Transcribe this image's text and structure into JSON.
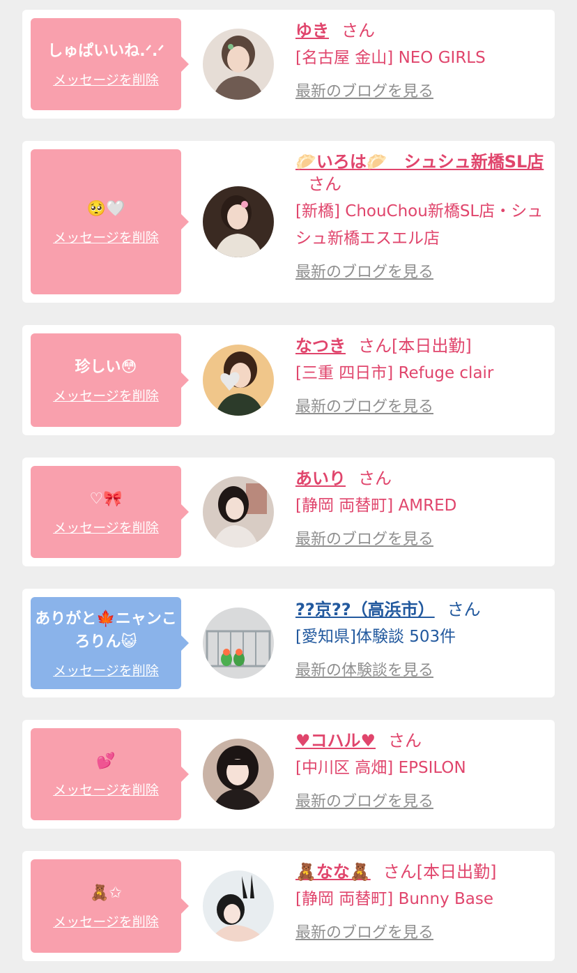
{
  "delete_label": "メッセージを削除",
  "colors": {
    "pink_bubble": "#f9a0ad",
    "blue_bubble": "#8ab3ea",
    "pink_text": "#e0456c",
    "blue_text": "#22599e",
    "link_gray": "#8f8f8f"
  },
  "items": [
    {
      "message": "しゅぱいいね.ᐟ.ᐟ",
      "name": "ゆき",
      "honorific": "さん",
      "extra": "",
      "shop": "[名古屋 金山] NEO GIRLS",
      "link": "最新のブログを見る",
      "theme": "pink",
      "avatar": "girl-photo"
    },
    {
      "message": "🥺🤍",
      "name": "🥟いろは🥟　シュシュ新橋SL店",
      "honorific": "さん",
      "extra": "",
      "shop": "[新橋] ChouChou新橋SL店・シュシュ新橋エスエル店",
      "link": "最新のブログを見る",
      "theme": "pink",
      "avatar": "girl-photo"
    },
    {
      "message": "珍しい😳",
      "name": "なつき",
      "honorific": "さん",
      "extra": "[本日出勤]",
      "shop": "[三重 四日市] Refuge clair",
      "link": "最新のブログを見る",
      "theme": "pink",
      "avatar": "girl-photo"
    },
    {
      "message": "♡🎀",
      "name": "あいり",
      "honorific": "さん",
      "extra": "",
      "shop": "[静岡 両替町] AMRED",
      "link": "最新のブログを見る",
      "theme": "pink",
      "avatar": "girl-photo"
    },
    {
      "message": "ありがと🍁ニャンころりん😺",
      "name": "??京??（高浜市）",
      "honorific": "さん",
      "extra": "",
      "shop": "[愛知県]体験談 503件",
      "link": "最新の体験談を見る",
      "theme": "blue",
      "avatar": "parrot-photo"
    },
    {
      "message": "💕",
      "name": "♥コハル♥",
      "honorific": "さん",
      "extra": "",
      "shop": "[中川区 高畑] EPSILON",
      "link": "最新のブログを見る",
      "theme": "pink",
      "avatar": "girl-photo"
    },
    {
      "message": "🧸✩",
      "name": "🧸なな🧸",
      "honorific": "さん",
      "extra": "[本日出勤]",
      "shop": "[静岡 両替町] Bunny Base",
      "link": "最新のブログを見る",
      "theme": "pink",
      "avatar": "girl-photo"
    }
  ]
}
